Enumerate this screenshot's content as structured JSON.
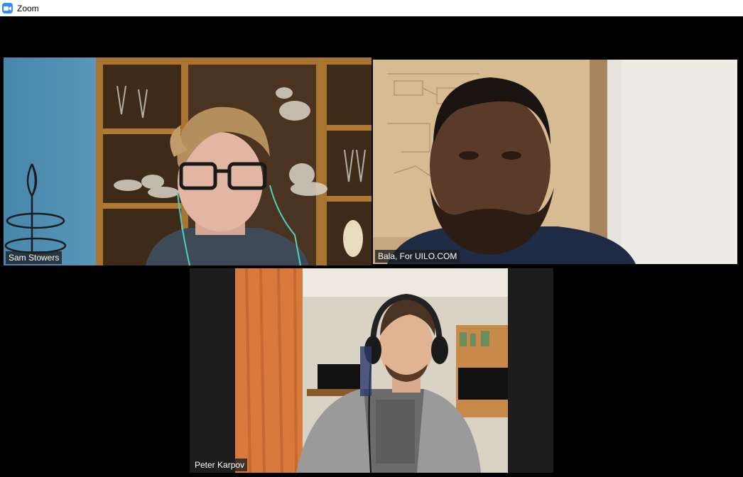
{
  "window": {
    "title": "Zoom",
    "icon": "zoom-camera-icon",
    "accent": "#2d8cff"
  },
  "gallery": {
    "active_speaker_border": "#e6ea7a",
    "participants": [
      {
        "name": "Sam Stowers",
        "active": true
      },
      {
        "name": "Bala, For UILO.COM",
        "active": false
      },
      {
        "name": "Peter Karpov",
        "active": false
      }
    ]
  }
}
